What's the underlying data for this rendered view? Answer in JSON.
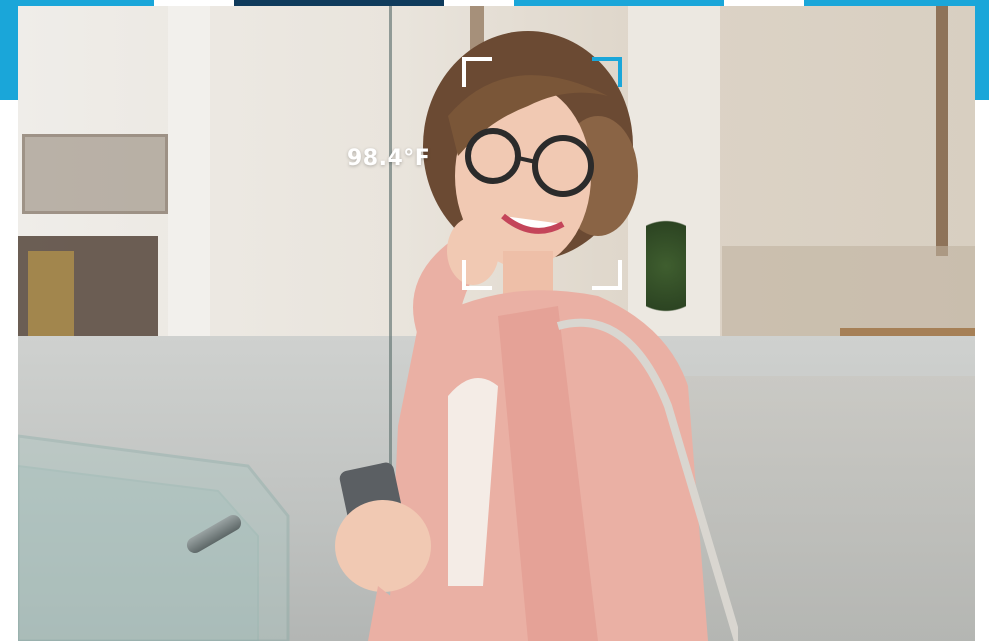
{
  "temperature": {
    "reading": "98.4°F"
  },
  "colors": {
    "accent": "#1aa6d9",
    "accent_dark": "#0f3b5c",
    "bracket": "#ffffff",
    "jacket": "#eab0a4"
  },
  "icons": {
    "scan_frame": "face-scan-bracket-icon"
  }
}
